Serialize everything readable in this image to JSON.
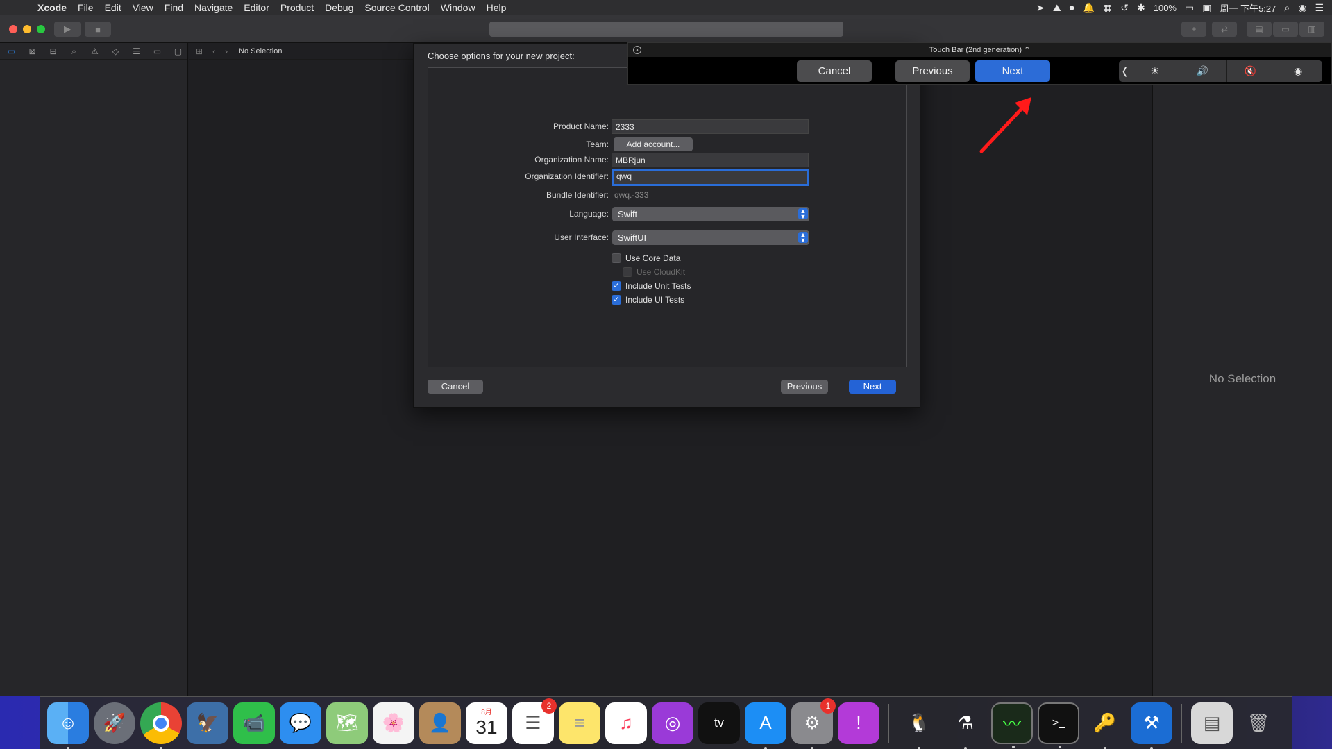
{
  "menubar": {
    "app_name": "Xcode",
    "items": [
      "File",
      "Edit",
      "View",
      "Find",
      "Navigate",
      "Editor",
      "Product",
      "Debug",
      "Source Control",
      "Window",
      "Help"
    ],
    "battery": "100%",
    "clock": "周一 下午5:27"
  },
  "toolbar": {
    "run_icon": "play-icon",
    "stop_icon": "stop-icon"
  },
  "navigator": {
    "tab_icons": [
      "folder-icon",
      "source-control-icon",
      "symbol-icon",
      "find-icon",
      "issue-icon",
      "test-icon",
      "debug-icon",
      "breakpoint-icon",
      "report-icon"
    ]
  },
  "editor": {
    "jump_title": "No Selection"
  },
  "inspector": {
    "empty_text": "No Selection"
  },
  "sheet": {
    "title": "Choose options for your new project:",
    "product_name_label": "Product Name:",
    "product_name_value": "2333",
    "team_label": "Team:",
    "team_button": "Add account...",
    "org_name_label": "Organization Name:",
    "org_name_value": "MBRjun",
    "org_id_label": "Organization Identifier:",
    "org_id_value": "qwq",
    "bundle_id_label": "Bundle Identifier:",
    "bundle_id_value": "qwq.-333",
    "language_label": "Language:",
    "language_value": "Swift",
    "ui_label": "User Interface:",
    "ui_value": "SwiftUI",
    "use_core_data": "Use Core Data",
    "use_cloudkit": "Use CloudKit",
    "include_unit_tests": "Include Unit Tests",
    "include_ui_tests": "Include UI Tests",
    "cancel": "Cancel",
    "previous": "Previous",
    "next": "Next"
  },
  "touchbar": {
    "title": "Touch Bar (2nd generation) ⌃",
    "cancel": "Cancel",
    "previous": "Previous",
    "next": "Next",
    "controls": [
      "chevron-left-icon",
      "brightness-icon",
      "volume-icon",
      "mute-icon",
      "siri-icon"
    ]
  },
  "dock": {
    "calendar_month": "8月",
    "calendar_day": "31",
    "reminders_badge": "2",
    "settings_badge": "1",
    "tv_label": "tv",
    "apps": [
      "Finder",
      "Launchpad",
      "Chrome",
      "Preview",
      "FaceTime",
      "Messages",
      "Maps",
      "Photos",
      "Contacts",
      "Calendar",
      "Reminders",
      "Notes",
      "Music",
      "Podcasts",
      "TV",
      "App Store",
      "System Preferences",
      "Feedback Assistant",
      "QQ",
      "Instruments",
      "Activity Monitor",
      "Terminal",
      "Keychain Access",
      "Xcode",
      "Downloads",
      "Trash"
    ]
  },
  "colors": {
    "accent": "#2463d6",
    "arrow": "#ff1a1a"
  }
}
